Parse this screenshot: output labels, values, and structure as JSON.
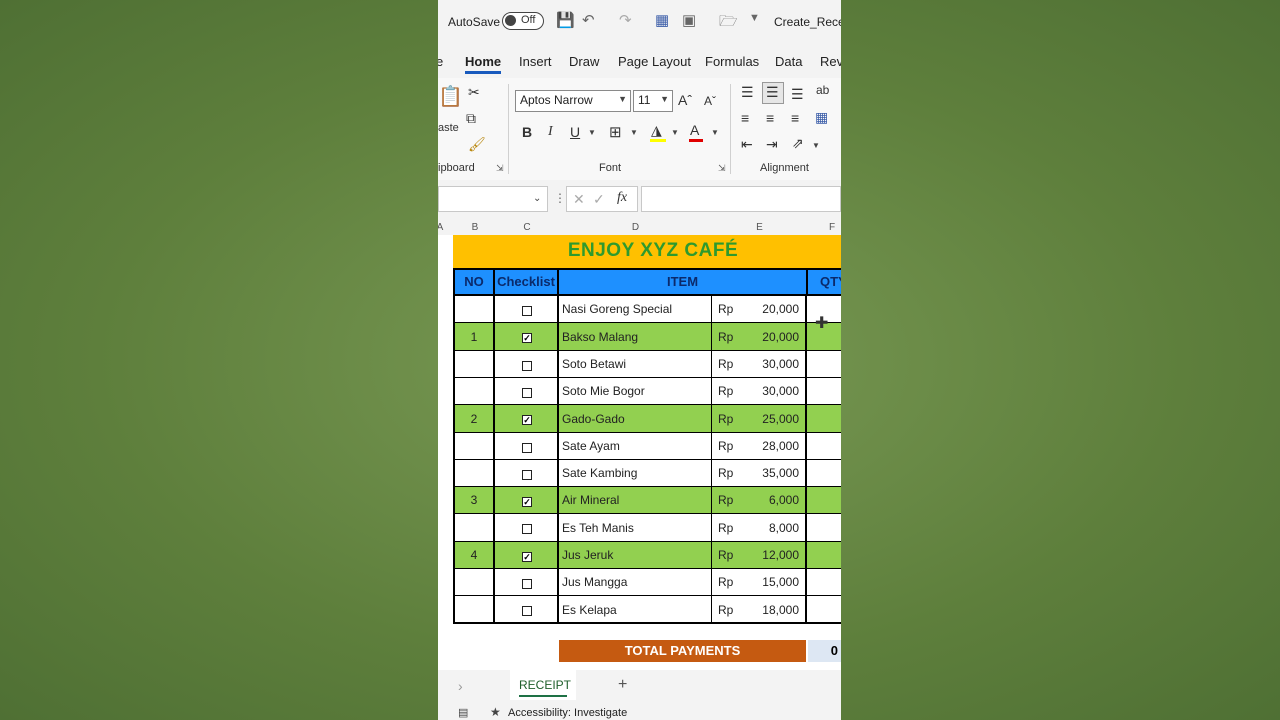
{
  "titlebar": {
    "autosave_label": "AutoSave",
    "autosave_state": "Off",
    "filename": "Create_Receip"
  },
  "menu": {
    "items": [
      "e",
      "Home",
      "Insert",
      "Draw",
      "Page Layout",
      "Formulas",
      "Data",
      "Rev"
    ]
  },
  "ribbon": {
    "clipboard_label": "ipboard",
    "paste_label": "aste",
    "font_name": "Aptos Narrow",
    "font_size": "11",
    "font_group_label": "Font",
    "alignment_group_label": "Alignment",
    "bold": "B",
    "italic": "I",
    "underline": "U"
  },
  "formula_bar": {
    "fx": "fx",
    "value": ""
  },
  "columns": [
    "A",
    "B",
    "C",
    "D",
    "E",
    "F"
  ],
  "sheet": {
    "banner": "ENJOY  XYZ CAFÉ",
    "headers": {
      "no": "NO",
      "checklist": "Checklist",
      "item": "ITEM",
      "qty": "QTY"
    },
    "currency": "Rp",
    "rows": [
      {
        "no": "",
        "checked": false,
        "item": "Nasi Goreng Special",
        "price": "20,000"
      },
      {
        "no": "1",
        "checked": true,
        "item": "Bakso Malang",
        "price": "20,000"
      },
      {
        "no": "",
        "checked": false,
        "item": "Soto Betawi",
        "price": "30,000"
      },
      {
        "no": "",
        "checked": false,
        "item": "Soto Mie Bogor",
        "price": "30,000"
      },
      {
        "no": "2",
        "checked": true,
        "item": "Gado-Gado",
        "price": "25,000"
      },
      {
        "no": "",
        "checked": false,
        "item": "Sate Ayam",
        "price": "28,000"
      },
      {
        "no": "",
        "checked": false,
        "item": "Sate Kambing",
        "price": "35,000"
      },
      {
        "no": "3",
        "checked": true,
        "item": "Air Mineral",
        "price": "6,000"
      },
      {
        "no": "",
        "checked": false,
        "item": "Es Teh Manis",
        "price": "8,000"
      },
      {
        "no": "4",
        "checked": true,
        "item": "Jus Jeruk",
        "price": "12,000"
      },
      {
        "no": "",
        "checked": false,
        "item": "Jus Mangga",
        "price": "15,000"
      },
      {
        "no": "",
        "checked": false,
        "item": "Es Kelapa",
        "price": "18,000"
      }
    ],
    "total_label": "TOTAL PAYMENTS",
    "total_value": "0"
  },
  "tabs": {
    "active": "RECEIPT",
    "add": "+"
  },
  "status": {
    "accessibility": "Accessibility: Investigate"
  },
  "colors": {
    "banner": "#ffc000",
    "header": "#1e90ff",
    "selected_row": "#92d050",
    "total": "#c55a11"
  }
}
